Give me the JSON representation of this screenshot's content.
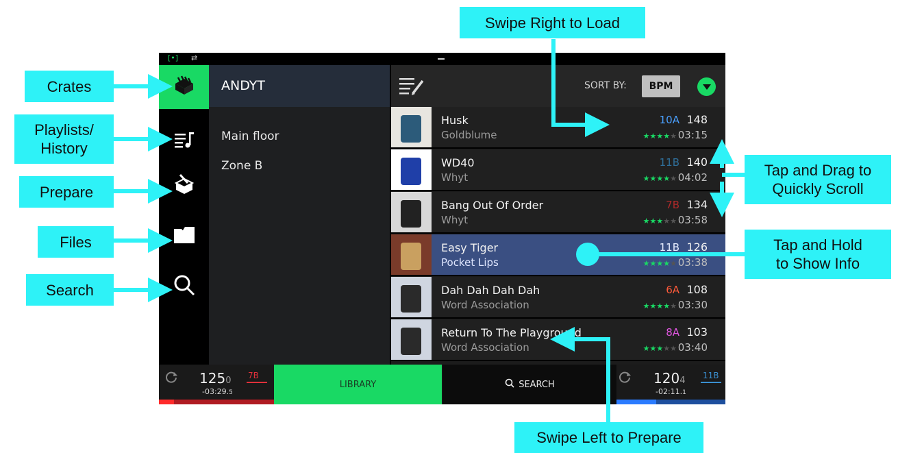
{
  "callouts": {
    "crates": "Crates",
    "playlists_line1": "Playlists/",
    "playlists_line2": "History",
    "prepare": "Prepare",
    "files": "Files",
    "search": "Search",
    "swipe_right": "Swipe Right to Load",
    "tap_drag_line1": "Tap and Drag to",
    "tap_drag_line2": "Quickly Scroll",
    "tap_hold_line1": "Tap and Hold",
    "tap_hold_line2": "to Show Info",
    "swipe_left": "Swipe Left to Prepare"
  },
  "sidebar": {
    "items": [
      {
        "icon": "crates-icon",
        "active": true
      },
      {
        "icon": "playlist-icon",
        "active": false
      },
      {
        "icon": "prepare-icon",
        "active": false
      },
      {
        "icon": "folder-icon",
        "active": false
      },
      {
        "icon": "search-icon",
        "active": false
      }
    ]
  },
  "crates": {
    "header": "ANDYT",
    "items": [
      "Main floor",
      "Zone B"
    ]
  },
  "tracklist": {
    "sort_label": "SORT BY:",
    "sort_value": "BPM",
    "tracks": [
      {
        "title": "Husk",
        "artist": "Goldblume",
        "key": "10A",
        "key_color": "#4aa0ff",
        "rating": 4,
        "bpm": "148",
        "time": "03:15"
      },
      {
        "title": "WD40",
        "artist": "Whyt",
        "key": "11B",
        "key_color": "#2f6f9a",
        "rating": 4,
        "bpm": "140",
        "time": "04:02"
      },
      {
        "title": "Bang Out Of Order",
        "artist": "Whyt",
        "key": "7B",
        "key_color": "#b02a2a",
        "rating": 3,
        "bpm": "134",
        "time": "03:58"
      },
      {
        "title": "Easy Tiger",
        "artist": "Pocket Lips",
        "key": "11B",
        "key_color": "#e8eeff",
        "rating": 4,
        "bpm": "126",
        "time": "03:38",
        "selected": true
      },
      {
        "title": "Dah Dah Dah Dah",
        "artist": "Word Association",
        "key": "6A",
        "key_color": "#ff5a3a",
        "rating": 4,
        "bpm": "108",
        "time": "03:30"
      },
      {
        "title": "Return To The Playground",
        "artist": "Word Association",
        "key": "8A",
        "key_color": "#e056e0",
        "rating": 3,
        "bpm": "103",
        "time": "03:40"
      }
    ]
  },
  "bottom": {
    "deck1": {
      "bpm_main": "125",
      "bpm_dec": "0",
      "key": "7B",
      "key_color": "#e0303a",
      "remaining": "-03:29.",
      "remaining_dec": "5"
    },
    "library_label": "LIBRARY",
    "search_label": "SEARCH",
    "deck2": {
      "bpm_main": "120",
      "bpm_dec": "4",
      "key": "11B",
      "key_color": "#3a8fd0",
      "remaining": "-02:11.",
      "remaining_dec": "1"
    }
  },
  "colors": {
    "callout_bg": "#2ef2f7",
    "accent_green": "#19d964",
    "selected_row": "#3a4f82",
    "star_on": "#19d964",
    "star_off": "#555555"
  }
}
